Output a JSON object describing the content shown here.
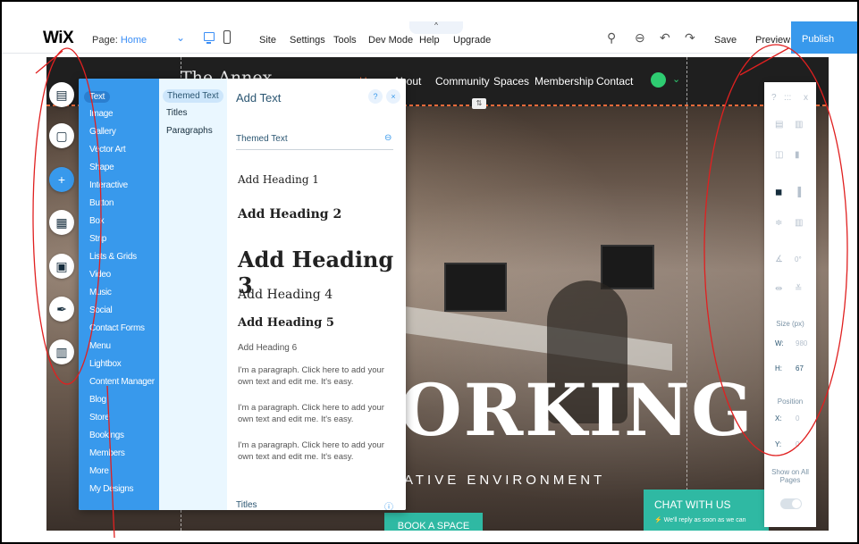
{
  "topbar": {
    "logo": "WiX",
    "page_label": "Page:",
    "page_value": "Home",
    "caret": "⌄",
    "menu": [
      "Site",
      "Settings",
      "Tools",
      "Dev Mode",
      "Help",
      "Upgrade"
    ],
    "collapse": "^",
    "save": "Save",
    "preview": "Preview",
    "publish": "Publish",
    "tool_icons": [
      "toolbox-icon",
      "zoom-icon",
      "undo-icon",
      "redo-icon"
    ]
  },
  "site": {
    "brand": "The Annex",
    "nav": [
      "Home",
      "About",
      "Community",
      "Spaces",
      "Membership",
      "Contact"
    ],
    "handle": "⇅",
    "hero_title": "ORKING",
    "hero_subtitle": "ATIVE ENVIRONMENT",
    "book_button": "BOOK A SPACE",
    "chat_title": "CHAT WITH US",
    "chat_sub": "⚡ We'll reply as soon as we can"
  },
  "rail": {
    "items": [
      "pages-icon",
      "background-icon",
      "add-icon",
      "add-apps-icon",
      "media-icon",
      "blog-icon",
      "bookings-icon"
    ],
    "glyphs": [
      "▤",
      "▢",
      "+",
      "▦",
      "▣",
      "✒",
      "▥"
    ]
  },
  "add_panel": {
    "categories": [
      "Text",
      "Image",
      "Gallery",
      "Vector Art",
      "Shape",
      "Interactive",
      "Button",
      "Box",
      "Strip",
      "Lists & Grids",
      "Video",
      "Music",
      "Social",
      "Contact Forms",
      "Menu",
      "Lightbox",
      "Content Manager",
      "Blog",
      "Store",
      "Bookings",
      "Members",
      "More",
      "My Designs"
    ],
    "subcategories": [
      "Themed Text",
      "Titles",
      "Paragraphs"
    ],
    "title": "Add Text",
    "help": "?",
    "close": "×",
    "section_themed": "Themed Text",
    "section_titles": "Titles",
    "headings": [
      "Add Heading 1",
      "Add Heading 2",
      "Add Heading 3",
      "Add Heading 4",
      "Add Heading 5",
      "Add Heading 6"
    ],
    "paragraphs": [
      "I'm a paragraph. Click here to add your own text and edit me. It's easy.",
      "I'm a paragraph. Click here to add your own text and edit me. It's easy.",
      "I'm a paragraph. Click here to add your own text and edit me. It's easy."
    ]
  },
  "right_panel": {
    "top": "?",
    "grip": ":::",
    "close": "x",
    "angle_value": "0°",
    "size_label": "Size (px)",
    "w_label": "W:",
    "w_value": "980",
    "h_label": "H:",
    "h_value": "67",
    "position_label": "Position",
    "x_label": "X:",
    "x_value": "0",
    "y_label": "Y:",
    "y_value": "0",
    "show_all_pages": "Show on All Pages"
  },
  "colors": {
    "wix_blue": "#3899ec",
    "orange_accent": "#e96a3a",
    "teal_button": "#2fb9a3",
    "annotation_red": "#e02020"
  }
}
